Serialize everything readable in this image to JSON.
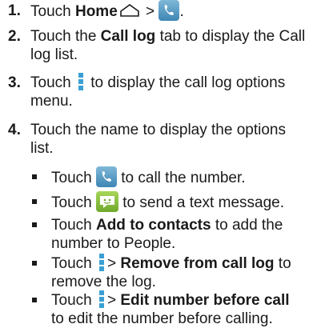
{
  "steps": [
    {
      "num": "1.",
      "pre": "Touch ",
      "bold": "Home",
      "mid": " > ",
      "post": "."
    },
    {
      "num": "2.",
      "pre": "Touch the ",
      "bold": "Call log",
      "post": " tab to display the Call log list."
    },
    {
      "num": "3.",
      "pre": "Touch ",
      "post": " to display the call log options menu."
    },
    {
      "num": "4.",
      "text": "Touch the name to display the options list."
    }
  ],
  "subitems": [
    {
      "pre": "Touch ",
      "post": " to call the number."
    },
    {
      "pre": "Touch ",
      "post": " to send a text message."
    },
    {
      "pre": "Touch ",
      "bold": "Add to contacts",
      "post": " to add the number to People."
    },
    {
      "pre": "Touch ",
      "mid": "> ",
      "bold": "Remove from call log",
      "post": " to remove the log."
    },
    {
      "pre": "Touch ",
      "mid": "> ",
      "bold": "Edit number before call",
      "post": " to edit the number before calling."
    }
  ],
  "icons": {
    "home": "home-icon",
    "phone": "phone-icon",
    "message": "message-icon",
    "menu": "menu-icon"
  }
}
